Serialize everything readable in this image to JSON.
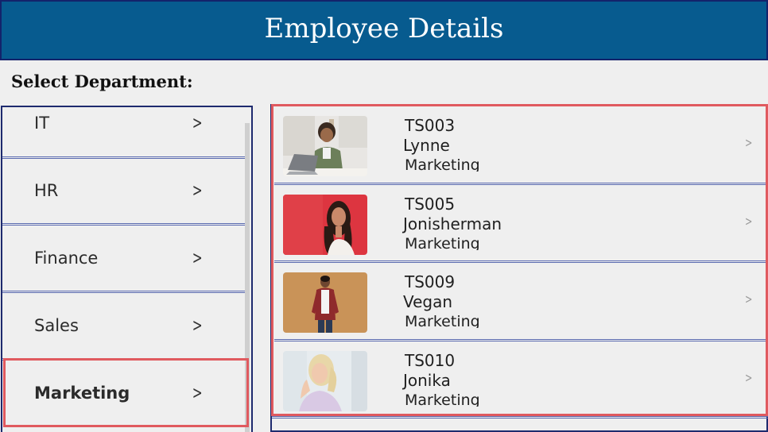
{
  "header": {
    "title": "Employee Details",
    "bg_color": "#075b8f"
  },
  "select_label": "Select Department:",
  "departments": [
    {
      "label": "IT",
      "chevron": ">"
    },
    {
      "label": "HR",
      "chevron": ">"
    },
    {
      "label": "Finance",
      "chevron": ">"
    },
    {
      "label": "Sales",
      "chevron": ">"
    },
    {
      "label": "Marketing",
      "chevron": ">",
      "selected": true
    }
  ],
  "employees": [
    {
      "id": "TS003",
      "name": "Lynne",
      "department": "Marketing",
      "photo": "man-with-laptop-photo",
      "chevron": ">"
    },
    {
      "id": "TS005",
      "name": "Jonisherman",
      "department": "Marketing",
      "photo": "woman-red-background-photo",
      "chevron": ">"
    },
    {
      "id": "TS009",
      "name": "Vegan",
      "department": "Marketing",
      "photo": "man-plaid-shirt-photo",
      "chevron": ">"
    },
    {
      "id": "TS010",
      "name": "Jonika",
      "department": "Marketing",
      "photo": "woman-smiling-photo",
      "chevron": ">"
    }
  ],
  "colors": {
    "highlight": "#e05a5f",
    "border": "#1e2a6e"
  }
}
